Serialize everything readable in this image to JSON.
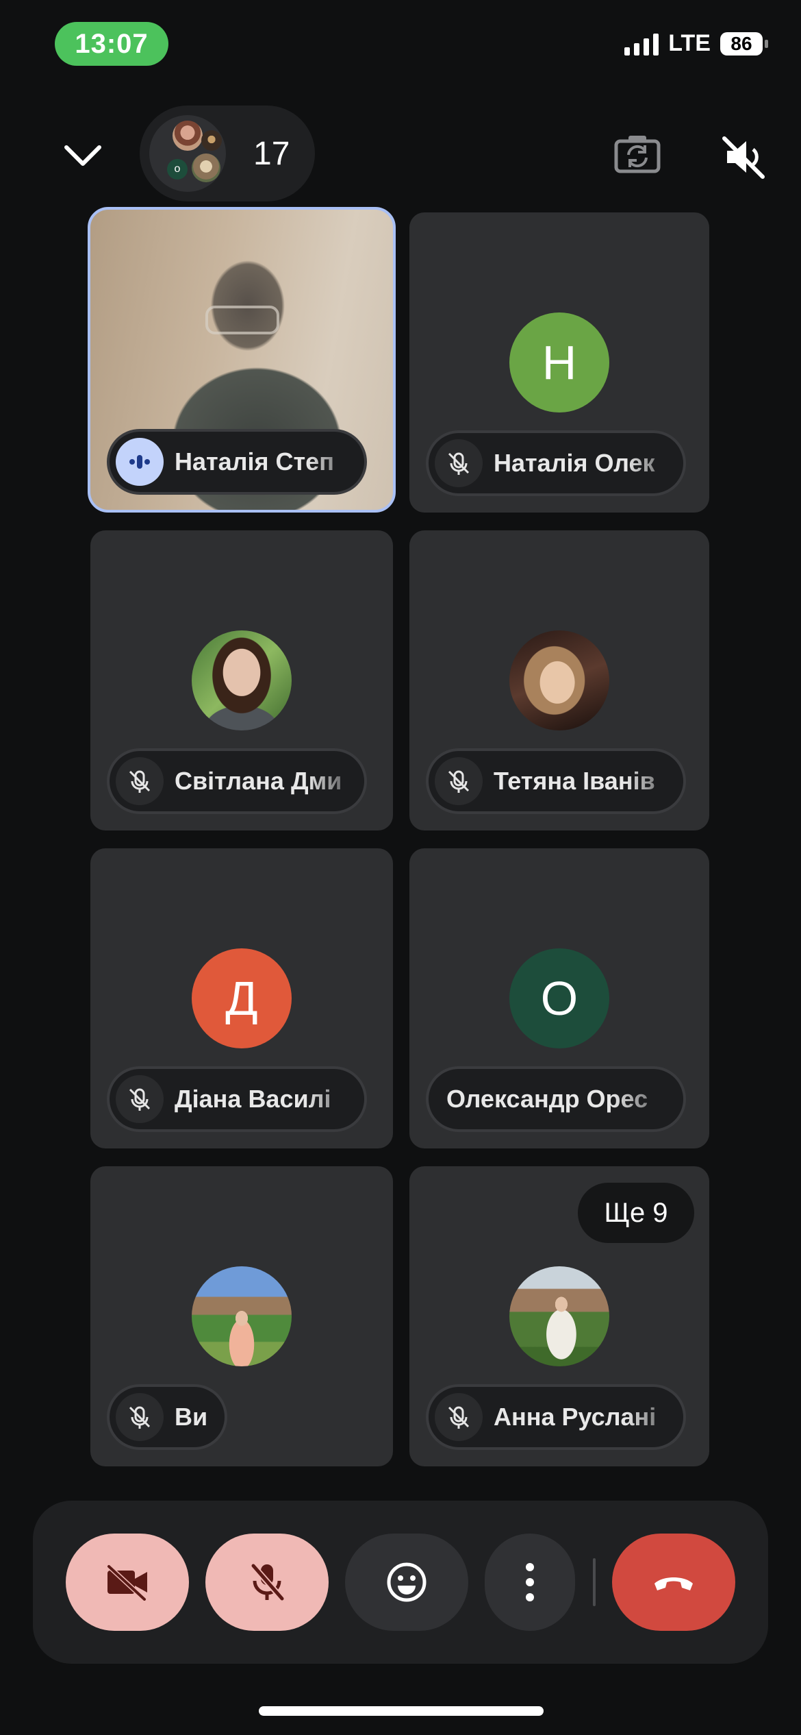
{
  "status_bar": {
    "time": "13:07",
    "network": "LTE",
    "battery": "86"
  },
  "header": {
    "participant_count": "17",
    "icons": [
      "chevron-down-icon",
      "camera-switch-icon",
      "speaker-off-icon"
    ]
  },
  "tiles": [
    {
      "name": "Наталія Степ",
      "mic": "speaking",
      "type": "video"
    },
    {
      "name": "Наталія Олек",
      "mic": "muted",
      "type": "letter",
      "letter": "Н",
      "color": "#6aa545"
    },
    {
      "name": "Світлана Дми",
      "mic": "muted",
      "type": "photo"
    },
    {
      "name": "Тетяна Іванів",
      "mic": "muted",
      "type": "photo"
    },
    {
      "name": "Діана Василі",
      "mic": "muted",
      "type": "letter",
      "letter": "Д",
      "color": "#e0593a"
    },
    {
      "name": "Олександр Орес",
      "mic": "none",
      "type": "letter",
      "letter": "О",
      "color": "#1d4d3b"
    },
    {
      "name": "Ви",
      "mic": "muted",
      "type": "photo"
    },
    {
      "name": "Анна Руслані",
      "mic": "muted",
      "type": "photo"
    }
  ],
  "more_badge": "Ще 9",
  "controls": {
    "icons": [
      "camera-off-icon",
      "mic-off-icon",
      "emoji-icon",
      "more-vert-icon",
      "end-call-icon"
    ],
    "colors": {
      "pink": "#f0b9b5",
      "grey": "#303134",
      "red": "#d1493f"
    }
  }
}
